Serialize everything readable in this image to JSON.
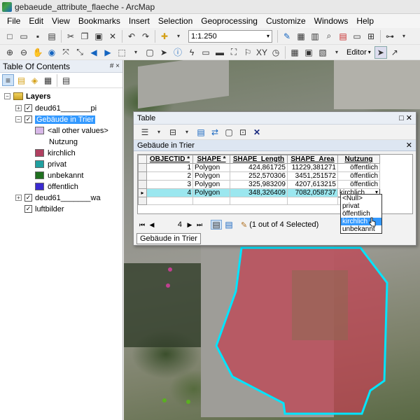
{
  "window": {
    "title": "gebaeude_attribute_flaeche - ArcMap"
  },
  "menu": [
    "File",
    "Edit",
    "View",
    "Bookmarks",
    "Insert",
    "Selection",
    "Geoprocessing",
    "Customize",
    "Windows",
    "Help"
  ],
  "toolbar": {
    "scale": "1:1.250",
    "editor_label": "Editor"
  },
  "toc": {
    "header": "Table Of Contents",
    "controls": "# ×",
    "root": "Layers",
    "layer1": "deud61_______pi",
    "layer2": "Gebäude in Trier",
    "all_other": "<all other values>",
    "field": "Nutzung",
    "classes": [
      {
        "label": "kirchlich",
        "color": "#b04060"
      },
      {
        "label": "privat",
        "color": "#20a0a0"
      },
      {
        "label": "unbekannt",
        "color": "#207020"
      },
      {
        "label": "öffentlich",
        "color": "#3a2ad0"
      }
    ],
    "all_other_color": "#d8b8e8",
    "layer3": "deud61_______wa",
    "layer4": "luftbilder"
  },
  "table_window": {
    "title": "Table",
    "subtitle": "Gebäude in Trier",
    "columns": [
      "OBJECTID *",
      "SHAPE *",
      "SHAPE_Length",
      "SHAPE_Area",
      "Nutzung"
    ],
    "rows": [
      {
        "id": "1",
        "shape": "Polygon",
        "length": "424,861725",
        "area": "11229,381271",
        "nutzung": "öffentlich"
      },
      {
        "id": "2",
        "shape": "Polygon",
        "length": "252,570306",
        "area": "3451,251572",
        "nutzung": "öffentlich"
      },
      {
        "id": "3",
        "shape": "Polygon",
        "length": "325,983209",
        "area": "4207,613215",
        "nutzung": "öffentlich"
      },
      {
        "id": "4",
        "shape": "Polygon",
        "length": "348,326409",
        "area": "7082,058737",
        "nutzung": "kirchlich"
      }
    ],
    "dropdown_options": [
      "<Null>",
      "privat",
      "öffentlich",
      "kirchlich",
      "unbekannt"
    ],
    "dropdown_selected": "kirchlich",
    "current_record": "4",
    "selection_status": "(1 out of 4 Selected)",
    "tab_label": "Gebäude in Trier"
  },
  "colors": {
    "selection_highlight": "#00e5ff",
    "selected_polygon_fill": "#c04050"
  }
}
